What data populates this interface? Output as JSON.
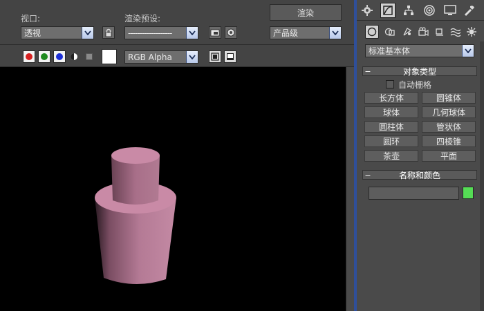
{
  "toolbar": {
    "viewport_label": "视口:",
    "viewport_value": "透视",
    "preset_label": "渲染预设:",
    "preset_value": "-------------------",
    "render_button": "渲染",
    "quality_value": "产品级",
    "channel_value": "RGB Alpha"
  },
  "colors": {
    "red_channel": "#d62020",
    "green_channel": "#1f8a1f",
    "blue_channel": "#1d2fd6",
    "object": "#c98aa6",
    "viewport_bg": "#000000",
    "object_color_swatch": "#55dd55",
    "panel_divider": "#2f4f9a"
  },
  "panel": {
    "tabs": [
      "create-icon",
      "modify-icon",
      "hierarchy-icon",
      "motion-icon",
      "display-icon",
      "utilities-icon"
    ],
    "subtabs": [
      "geometry-icon",
      "shapes-icon",
      "lights-icon",
      "cameras-icon",
      "helpers-icon",
      "spacewarps-icon",
      "systems-icon"
    ],
    "category_value": "标准基本体",
    "object_type": {
      "title": "对象类型",
      "autogrid_label": "自动栅格",
      "buttons": [
        "长方体",
        "圆锥体",
        "球体",
        "几何球体",
        "圆柱体",
        "管状体",
        "圆环",
        "四棱锥",
        "茶壶",
        "平面"
      ]
    },
    "name_color": {
      "title": "名称和颜色",
      "name_value": ""
    }
  }
}
